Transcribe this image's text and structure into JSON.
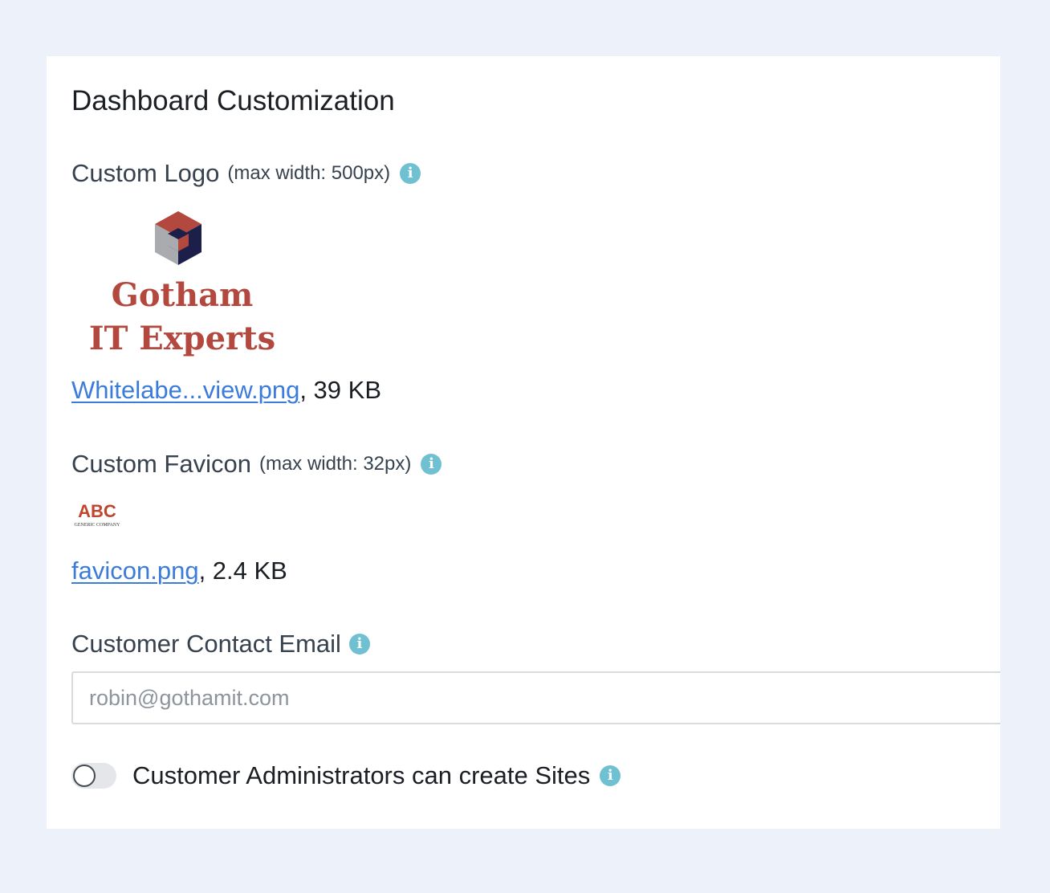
{
  "section": {
    "title": "Dashboard Customization"
  },
  "logo_field": {
    "label": "Custom Logo",
    "hint": "(max width: 500px)",
    "info_icon": "info-icon",
    "preview_text_line1": "Gotham",
    "preview_text_line2": "IT Experts",
    "file_name": "Whitelabe...view.png",
    "file_size": ", 39 KB"
  },
  "favicon_field": {
    "label": "Custom Favicon",
    "hint": "(max width: 32px)",
    "info_icon": "info-icon",
    "preview_text": "ABC",
    "preview_subtext": "GENERIC COMPANY",
    "file_name": "favicon.png",
    "file_size": ", 2.4 KB"
  },
  "email_field": {
    "label": "Customer Contact Email",
    "info_icon": "info-icon",
    "placeholder": "robin@gothamit.com",
    "value": ""
  },
  "site_toggle": {
    "label": "Customer Administrators can create Sites",
    "enabled": false,
    "info_icon": "info-icon"
  },
  "colors": {
    "page_background": "#edf1f9",
    "card_background": "#ffffff",
    "link": "#3b7bd9",
    "info_icon": "#6fc1d2",
    "logo_red": "#b2483e",
    "logo_navy": "#1c1f4a",
    "logo_gray": "#a9abae"
  }
}
